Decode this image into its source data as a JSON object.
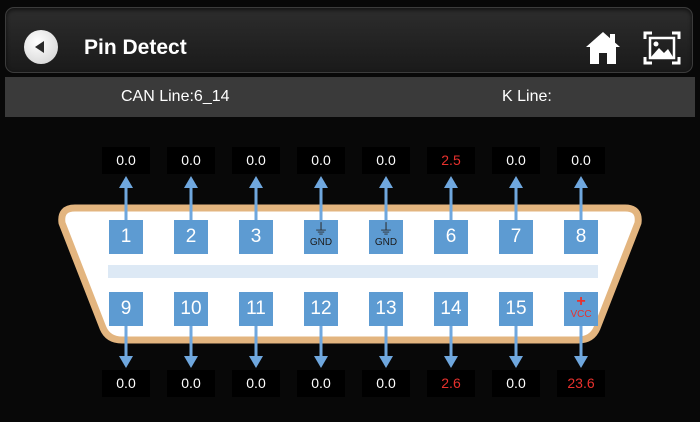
{
  "header": {
    "title": "Pin Detect"
  },
  "status": {
    "can_line": "CAN Line:6_14",
    "k_line": "K Line:"
  },
  "pins_top": [
    {
      "label": "1",
      "value": "0.0",
      "alert": false
    },
    {
      "label": "2",
      "value": "0.0",
      "alert": false
    },
    {
      "label": "3",
      "value": "0.0",
      "alert": false
    },
    {
      "label": "GND",
      "value": "0.0",
      "alert": false,
      "kind": "gnd"
    },
    {
      "label": "GND",
      "value": "0.0",
      "alert": false,
      "kind": "gnd"
    },
    {
      "label": "6",
      "value": "2.5",
      "alert": true
    },
    {
      "label": "7",
      "value": "0.0",
      "alert": false
    },
    {
      "label": "8",
      "value": "0.0",
      "alert": false
    }
  ],
  "pins_bottom": [
    {
      "label": "9",
      "value": "0.0",
      "alert": false
    },
    {
      "label": "10",
      "value": "0.0",
      "alert": false
    },
    {
      "label": "11",
      "value": "0.0",
      "alert": false
    },
    {
      "label": "12",
      "value": "0.0",
      "alert": false
    },
    {
      "label": "13",
      "value": "0.0",
      "alert": false
    },
    {
      "label": "14",
      "value": "2.6",
      "alert": true
    },
    {
      "label": "15",
      "value": "0.0",
      "alert": false
    },
    {
      "label": "VCC",
      "value": "23.6",
      "alert": true,
      "kind": "vcc"
    }
  ],
  "icons": {
    "back": "back-arrow-icon",
    "home": "home-icon",
    "screenshot": "screenshot-icon",
    "gnd": "ground-icon"
  },
  "colors": {
    "pin": "#5d9bd2",
    "connector_border": "#e3b57f",
    "alert_text": "#e8312d",
    "arrow": "#6fa7de"
  }
}
